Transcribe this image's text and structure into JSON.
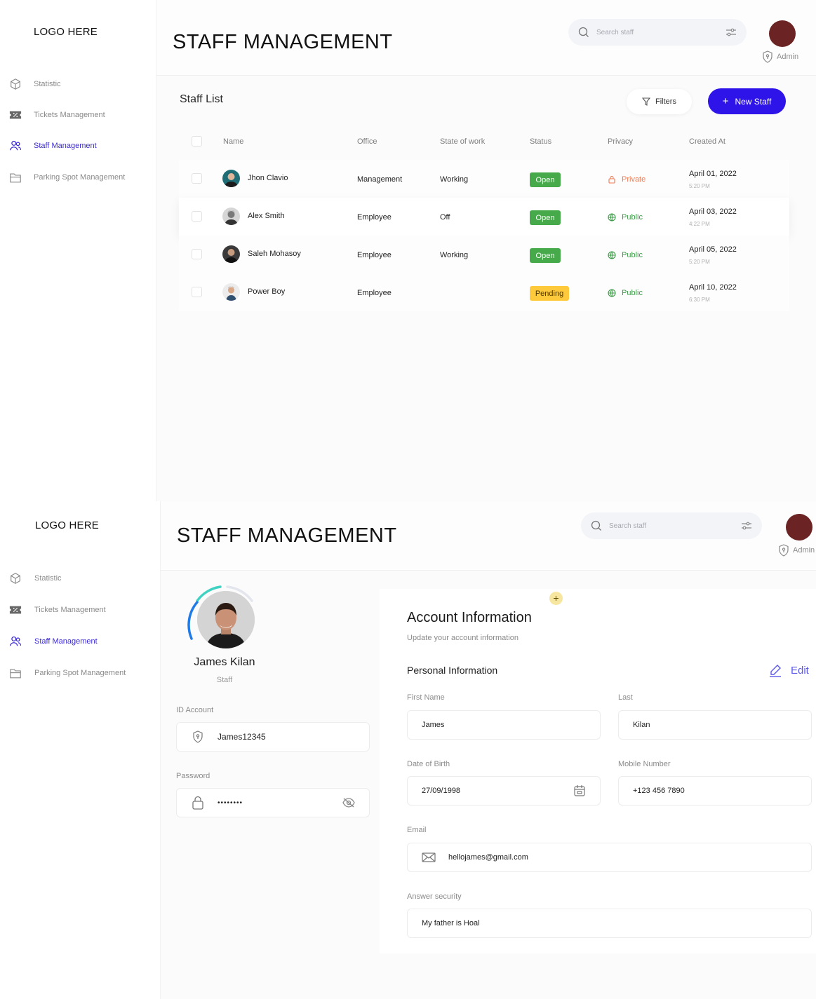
{
  "app": {
    "logo_text": "LOGO HERE",
    "page_title": "STAFF MANAGEMENT",
    "search_placeholder": "Search staff",
    "admin_label": "Admin",
    "avatar_color": "#6b2323",
    "accent_color": "#2e14e8"
  },
  "sidebar": {
    "items": [
      {
        "label": "Statistic",
        "icon": "cube-icon",
        "active": false
      },
      {
        "label": "Tickets Management",
        "icon": "ticket-icon",
        "active": false
      },
      {
        "label": "Staff Management",
        "icon": "users-icon",
        "active": true
      },
      {
        "label": "Parking Spot Management",
        "icon": "folder-icon",
        "active": false
      }
    ]
  },
  "staff_list": {
    "title": "Staff List",
    "filters_label": "Filters",
    "new_staff_label": "New Staff",
    "columns": [
      "Name",
      "Office",
      "State of work",
      "Status",
      "Privacy",
      "Created At"
    ],
    "rows": [
      {
        "name": "Jhon Clavio",
        "office": "Management",
        "state": "Working",
        "status": "Open",
        "privacy": "Private",
        "date": "April 01, 2022",
        "time": "5:20 PM"
      },
      {
        "name": "Alex Smith",
        "office": "Employee",
        "state": "Off",
        "status": "Open",
        "privacy": "Public",
        "date": "April 03, 2022",
        "time": "4:22 PM"
      },
      {
        "name": "Saleh Mohasoy",
        "office": "Employee",
        "state": "Working",
        "status": "Open",
        "privacy": "Public",
        "date": "April 05, 2022",
        "time": "5:20 PM"
      },
      {
        "name": "Power Boy",
        "office": "Employee",
        "state": "",
        "status": "Pending",
        "privacy": "Public",
        "date": "April 10, 2022",
        "time": "6:30 PM"
      }
    ],
    "status_colors": {
      "Open": "#46a94a",
      "Pending": "#ffc93c"
    }
  },
  "profile": {
    "name": "James Kilan",
    "role": "Staff",
    "id_label": "ID Account",
    "id_value": "James12345",
    "password_label": "Password",
    "password_value": "••••••••"
  },
  "account": {
    "title": "Account Information",
    "subtitle": "Update your account information",
    "section_title": "Personal Information",
    "edit_label": "Edit",
    "plus_label": "+",
    "first_name_label": "First Name",
    "first_name": "James",
    "last_label": "Last",
    "last_name": "Kilan",
    "dob_label": "Date of Birth",
    "dob": "27/09/1998",
    "mobile_label": "Mobile Number",
    "mobile": "+123 456 7890",
    "email_label": "Email",
    "email": "hellojames@gmail.com",
    "security_label": "Answer security",
    "security_answer": "My father is Hoal"
  }
}
